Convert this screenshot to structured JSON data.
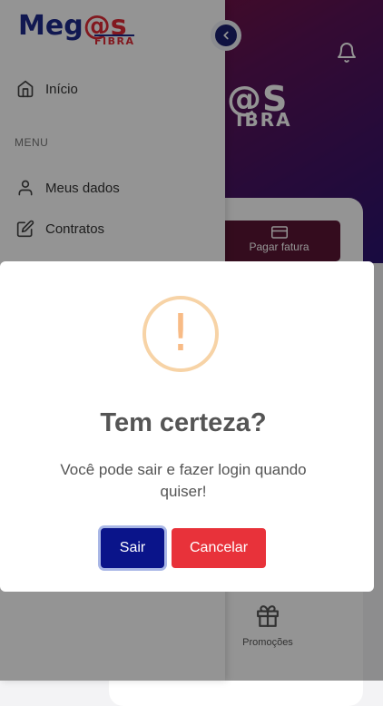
{
  "background": {
    "hero_logo_line1": "@S",
    "hero_logo_line2": "IBRA",
    "quick_action_label": "Pagar fatura",
    "promo_label": "Promoções"
  },
  "drawer": {
    "brand_part1": "Meg",
    "brand_part2": "@s",
    "brand_sub": "FIBRA",
    "home_label": "Início",
    "menu_header": "MENU",
    "items": [
      {
        "label": "Meus dados",
        "icon": "user-icon"
      },
      {
        "label": "Contratos",
        "icon": "edit-icon"
      }
    ]
  },
  "dialog": {
    "icon": "!",
    "title": "Tem certeza?",
    "text": "Você pode sair e fazer login quando quiser!",
    "confirm_label": "Sair",
    "cancel_label": "Cancelar"
  },
  "colors": {
    "confirm": "#0a148a",
    "cancel": "#e8323a",
    "warning": "#f8bb86",
    "brand_blue": "#1e2a8c",
    "brand_red": "#e02a36"
  }
}
